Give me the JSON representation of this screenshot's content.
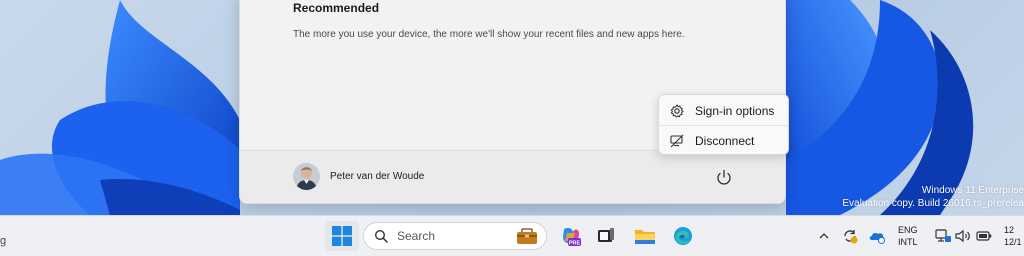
{
  "start_menu": {
    "recommended_title": "Recommended",
    "recommended_text": "The more you use your device, the more we'll show your recent files and new apps here.",
    "user_name": "Peter van der Woude",
    "power_icon": "power-icon"
  },
  "popup": {
    "items": [
      {
        "label": "Sign-in options",
        "icon": "gear-icon"
      },
      {
        "label": "Disconnect",
        "icon": "disconnect-icon"
      }
    ]
  },
  "watermark": {
    "line1": "Windows 11 Enterprise",
    "line2": "Evaluation copy. Build 26016.rs_prerelea"
  },
  "taskbar": {
    "left_clipped_text": "g",
    "search_label": "Search",
    "apps": [
      "start-icon",
      "copilot-icon",
      "task-view-icon",
      "file-explorer-icon",
      "edge-icon"
    ],
    "copilot_badge": "PRE"
  },
  "tray": {
    "lang_line1": "ENG",
    "lang_line2": "INTL",
    "time_clip": "12",
    "date_clip": "12/1"
  },
  "colors": {
    "wallpaper_blue": "#1a5fe0",
    "accent": "#0078d4"
  }
}
